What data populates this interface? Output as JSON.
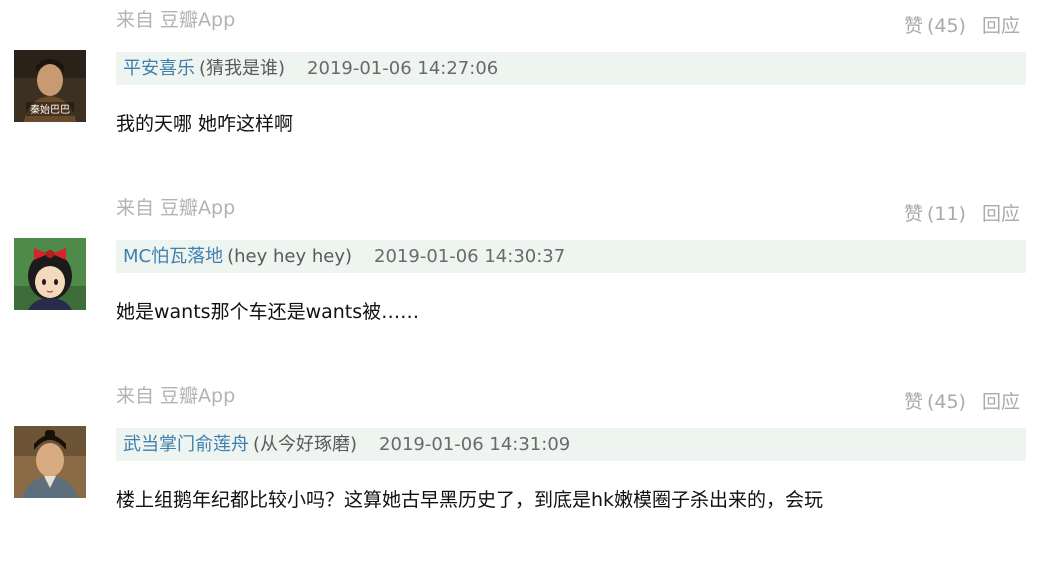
{
  "comments": [
    {
      "source": "来自 豆瓣App",
      "like_label": "赞",
      "like_count": "(45)",
      "reply_label": "回应",
      "avatar_caption": "秦始巴巴",
      "username": "平安喜乐",
      "signature": "(猜我是谁)",
      "time": "2019-01-06 14:27:06",
      "text": "我的天哪 她咋这样啊"
    },
    {
      "source": "来自 豆瓣App",
      "like_label": "赞",
      "like_count": "(11)",
      "reply_label": "回应",
      "username": "MC怕瓦落地",
      "signature": "(hey hey hey)",
      "time": "2019-01-06 14:30:37",
      "text": "她是wants那个车还是wants被……"
    },
    {
      "source": "来自 豆瓣App",
      "like_label": "赞",
      "like_count": "(45)",
      "reply_label": "回应",
      "username": "武当掌门俞莲舟",
      "signature": "(从今好琢磨)",
      "time": "2019-01-06 14:31:09",
      "text": "楼上组鹅年纪都比较小吗？这算她古早黑历史了，到底是hk嫩模圈子杀出来的，会玩"
    }
  ],
  "colors": {
    "username": "#3f7fae",
    "meta_background": "#eef4f0",
    "muted": "#b3b3b3"
  },
  "icons": {
    "avatar_1": "user-avatar-photo-man",
    "avatar_2": "user-avatar-cartoon-girl-red-bow",
    "avatar_3": "user-avatar-photo-man"
  }
}
